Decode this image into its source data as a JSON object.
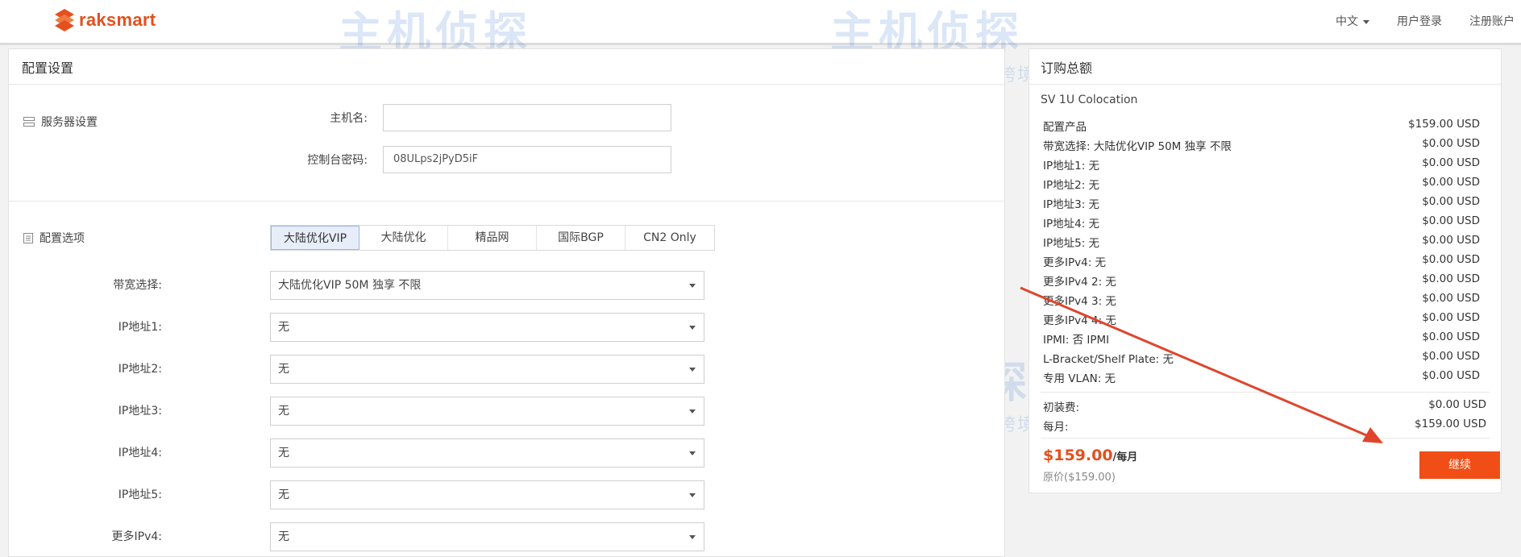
{
  "header": {
    "brand": "raksmart",
    "language": "中文",
    "login": "用户登录",
    "register": "注册账户"
  },
  "config": {
    "title": "配置设置",
    "server_section": "服务器设置",
    "hostname_label": "主机名:",
    "hostname_value": "",
    "password_label": "控制台密码:",
    "password_value": "08ULps2jPyD5iF",
    "options_section": "配置选项",
    "tabs": [
      "大陆优化VIP",
      "大陆优化",
      "精品网",
      "国际BGP",
      "CN2 Only"
    ],
    "active_tab": "大陆优化VIP",
    "fields": [
      {
        "label": "带宽选择:",
        "value": "大陆优化VIP 50M 独享 不限"
      },
      {
        "label": "IP地址1:",
        "value": "无"
      },
      {
        "label": "IP地址2:",
        "value": "无"
      },
      {
        "label": "IP地址3:",
        "value": "无"
      },
      {
        "label": "IP地址4:",
        "value": "无"
      },
      {
        "label": "IP地址5:",
        "value": "无"
      },
      {
        "label": "更多IPv4:",
        "value": "无"
      }
    ]
  },
  "summary": {
    "title": "订购总额",
    "product": "SV 1U Colocation",
    "items": [
      {
        "name": "配置产品",
        "price": "$159.00 USD"
      },
      {
        "name": "带宽选择: 大陆优化VIP 50M 独享 不限",
        "price": "$0.00 USD"
      },
      {
        "name": "IP地址1: 无",
        "price": "$0.00 USD"
      },
      {
        "name": "IP地址2: 无",
        "price": "$0.00 USD"
      },
      {
        "name": "IP地址3: 无",
        "price": "$0.00 USD"
      },
      {
        "name": "IP地址4: 无",
        "price": "$0.00 USD"
      },
      {
        "name": "IP地址5: 无",
        "price": "$0.00 USD"
      },
      {
        "name": "更多IPv4: 无",
        "price": "$0.00 USD"
      },
      {
        "name": "更多IPv4 2: 无",
        "price": "$0.00 USD"
      },
      {
        "name": "更多IPv4 3: 无",
        "price": "$0.00 USD"
      },
      {
        "name": "更多IPv4 4: 无",
        "price": "$0.00 USD"
      },
      {
        "name": "IPMI: 否 IPMI",
        "price": "$0.00 USD"
      },
      {
        "name": "L-Bracket/Shelf Plate: 无",
        "price": "$0.00 USD"
      },
      {
        "name": "专用 VLAN: 无",
        "price": "$0.00 USD"
      }
    ],
    "setup_label": "初装费:",
    "setup_value": "$0.00 USD",
    "monthly_label": "每月:",
    "monthly_value": "$159.00 USD",
    "total_price": "$159.00",
    "total_period": "/每月",
    "original_price": "原价($159.00)",
    "continue_label": "继续"
  },
  "watermark": {
    "text": "主机侦探",
    "subtitle": "服务跨境电商 助力中企出海"
  },
  "colors": {
    "brand": "#e4501e",
    "button": "#f04e16",
    "annotation_arrow": "#e0452c"
  }
}
